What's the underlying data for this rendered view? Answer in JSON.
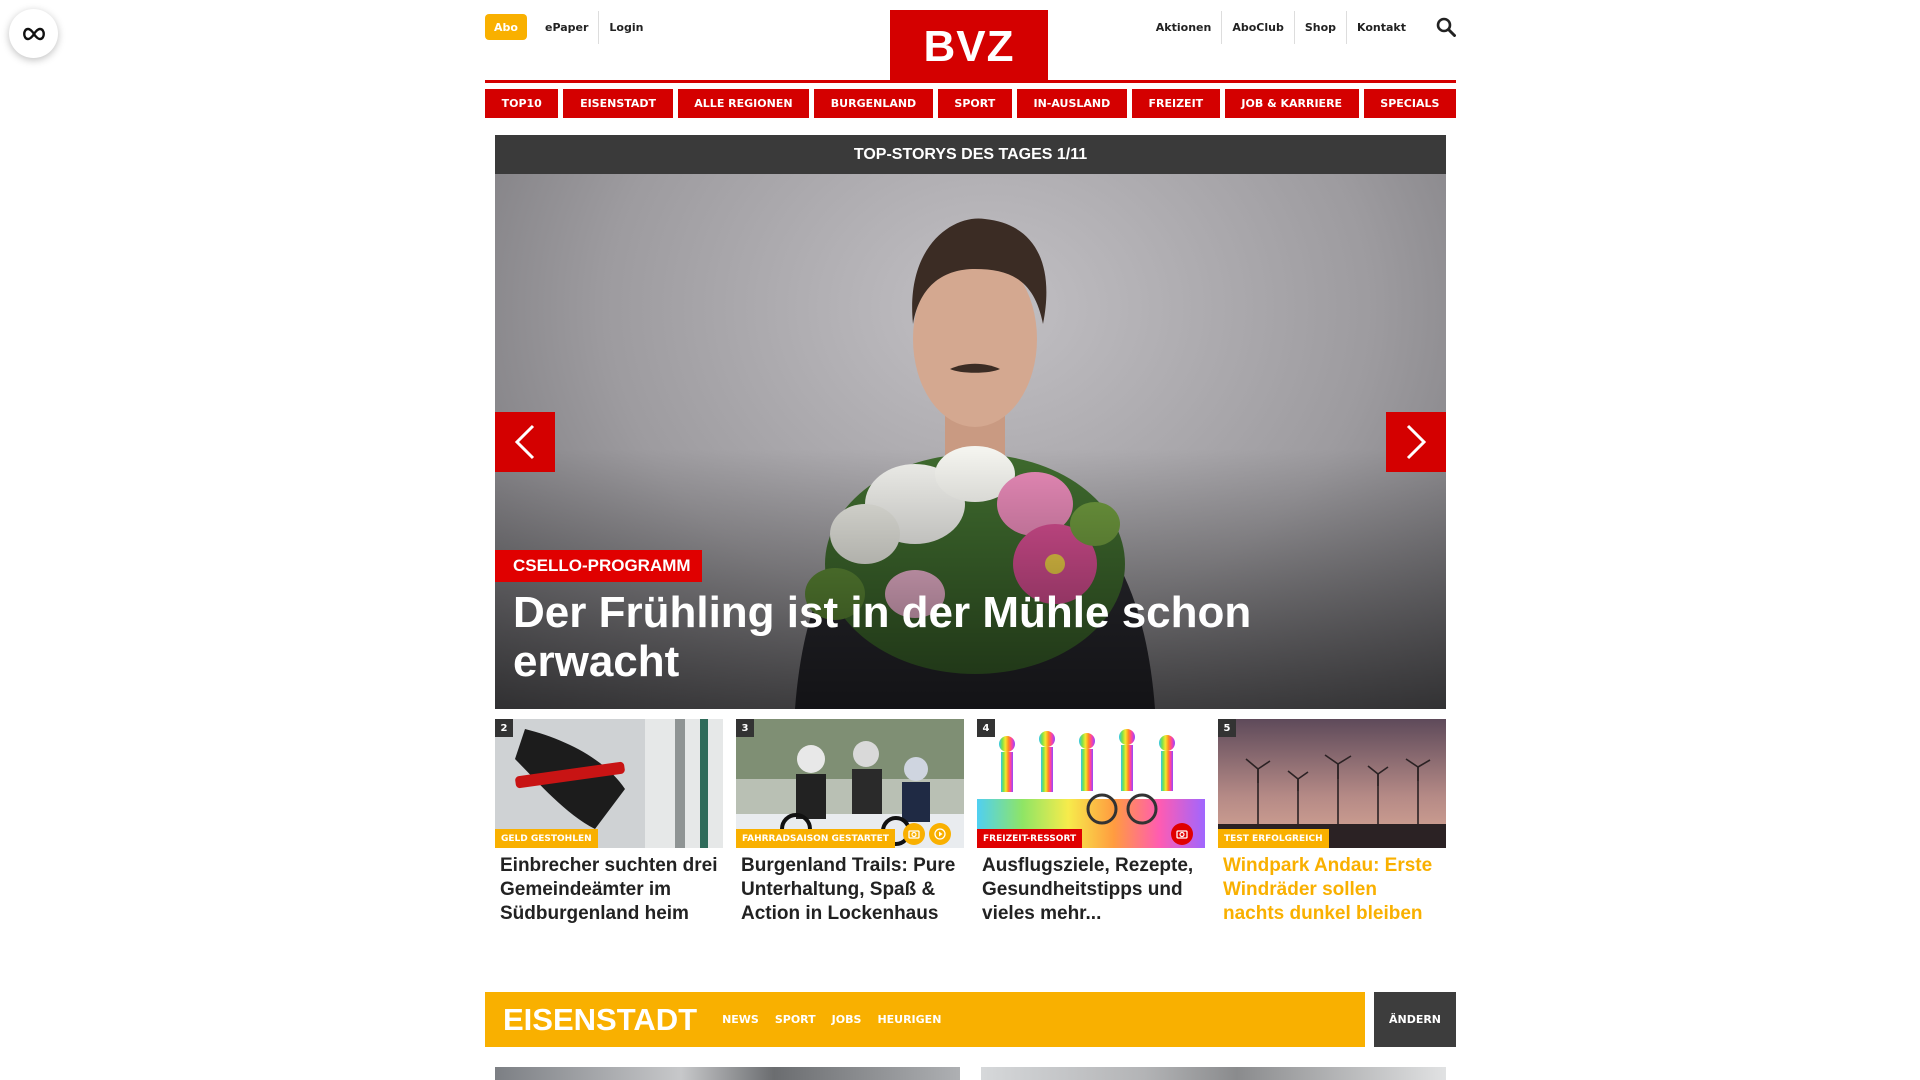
{
  "colors": {
    "brand_red": "#d40000",
    "accent_orange": "#f9b000",
    "dark_bar": "#3a3a3a"
  },
  "side_button": {
    "icon": "infinity-icon"
  },
  "header": {
    "abo_label": "Abo",
    "left_links": [
      "ePaper",
      "Login"
    ],
    "logo_text": "BVZ",
    "right_links": [
      "Aktionen",
      "AboClub",
      "Shop",
      "Kontakt"
    ],
    "search_icon": "search-icon"
  },
  "nav": {
    "items": [
      "TOP10",
      "EISENSTADT",
      "ALLE REGIONEN",
      "BURGENLAND",
      "SPORT",
      "IN-AUSLAND",
      "FREIZEIT",
      "JOB & KARRIERE",
      "SPECIALS"
    ]
  },
  "hero": {
    "bar_title": "TOP-STORYS DES TAGES 1/11",
    "tag": "CSELLO-PROGRAMM",
    "title": "Der Frühling ist in der Mühle schon erwacht",
    "prev_icon": "chevron-left-icon",
    "next_icon": "chevron-right-icon"
  },
  "teasers": [
    {
      "num": "2",
      "tag": "GELD GESTOHLEN",
      "title": "Einbrecher suchten drei Gemeindeämter im Südburgenland heim"
    },
    {
      "num": "3",
      "tag": "FAHRRADSAISON GESTARTET",
      "title": "Burgenland Trails: Pure Unterhaltung, Spaß & Action in Lockenhaus",
      "media": [
        "camera-icon",
        "play-icon"
      ]
    },
    {
      "num": "4",
      "tag": "FREIZEIT-RESSORT",
      "title": "Ausflugsziele, Rezepte, Gesundheitstipps und vieles mehr...",
      "media": [
        "camera-icon"
      ]
    },
    {
      "num": "5",
      "tag": "TEST ERFOLGREICH",
      "title": "Windpark Andau: Erste Windräder sollen nachts dunkel bleiben"
    }
  ],
  "section": {
    "title": "EISENSTADT",
    "links": [
      "NEWS",
      "SPORT",
      "JOBS",
      "HEURIGEN"
    ],
    "change_label": "ÄNDERN"
  }
}
